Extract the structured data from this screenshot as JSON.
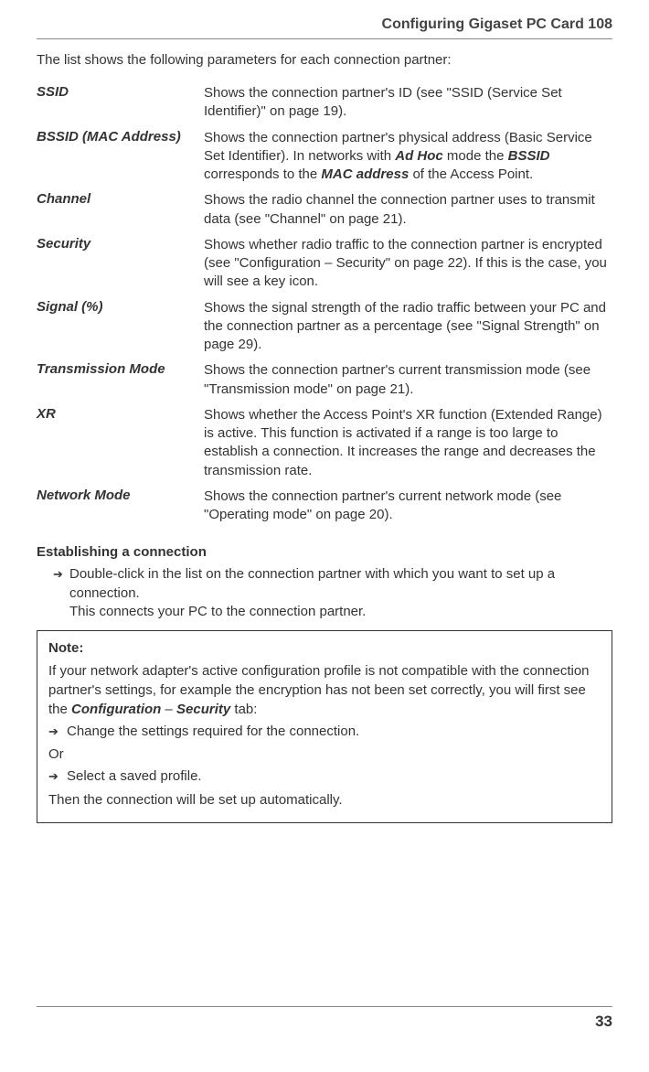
{
  "header": {
    "title": "Configuring Gigaset PC Card 108"
  },
  "intro": "The list shows the following parameters for each connection partner:",
  "definitions": [
    {
      "term": "SSID",
      "desc": "Shows the connection partner's ID (see \"SSID (Service Set Identifier)\" on page 19)."
    },
    {
      "term": "BSSID (MAC Address)",
      "desc": "Shows the connection partner's physical address (Basic Service Set Identifier). In networks with <span class=\"b\">Ad Hoc</span> mode the <span class=\"b\">BSSID</span> corresponds to the <span class=\"b\">MAC address</span> of the Access Point."
    },
    {
      "term": "Channel",
      "desc": "Shows the radio channel the connection partner uses to transmit data (see \"Channel\" on page 21)."
    },
    {
      "term": "Security",
      "desc": "Shows whether radio traffic to the connection partner is encrypted (see \"Configuration – Security\" on page 22). If this is the case, you will see a key icon."
    },
    {
      "term": "Signal (%)",
      "desc": "Shows the signal strength of the radio traffic between your PC and the connection partner as a percentage (see \"Signal Strength\" on page 29)."
    },
    {
      "term": "Transmission Mode",
      "desc": "Shows the connection partner's current transmission mode (see \"Transmission mode\" on page 21)."
    },
    {
      "term": "XR",
      "desc": "Shows whether the Access Point's XR function (Extended Range) is active. This function is activated if a range is too large to establish a connection. It increases the range and decreases the transmission rate."
    },
    {
      "term": "Network Mode",
      "desc": "Shows the connection partner's current network mode (see \"Operating mode\" on page 20)."
    }
  ],
  "establish": {
    "heading": "Establishing a connection",
    "step1": "Double-click in the list on the connection partner with which you want to set up a connection.",
    "step1b": "This connects your PC to the connection partner."
  },
  "note": {
    "label": "Note:",
    "body": "If your network adapter's active configuration profile is not compatible with the connection partner's settings, for example the encryption has not been set correctly, you will first see the <span class=\"b\">Configuration</span> – <span class=\"b\">Security</span> tab:",
    "opt1": "Change the settings required for the connection.",
    "or": "Or",
    "opt2": "Select a saved profile.",
    "tail": "Then the connection will be set up automatically."
  },
  "pageNumber": "33"
}
